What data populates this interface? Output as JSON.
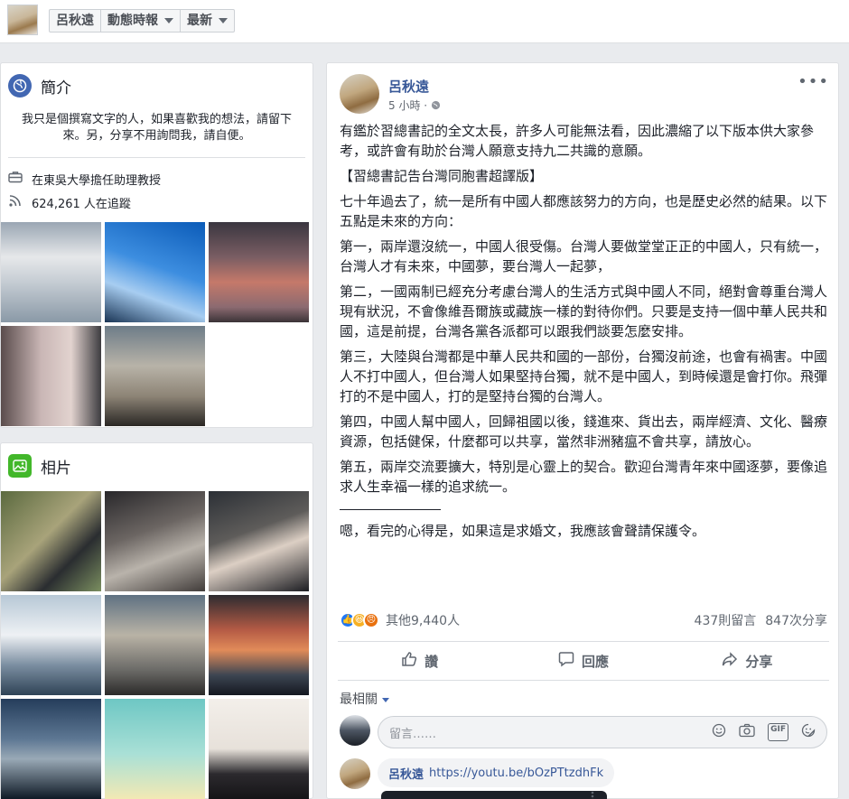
{
  "topbar": {
    "name": "呂秋遠",
    "feed_label": "動態時報",
    "sort_label": "最新"
  },
  "intro": {
    "title": "簡介",
    "bio": "我只是個撰寫文字的人，如果喜歡我的想法，請留下來。另，分享不用詢問我，請自便。",
    "job": "在東吳大學擔任助理教授",
    "followers": "624,261 人在追蹤"
  },
  "photos": {
    "title": "相片"
  },
  "post": {
    "author": "呂秋遠",
    "time": "5 小時 · ",
    "more": "•••",
    "paragraphs": [
      "有鑑於習總書記的全文太長，許多人可能無法看，因此濃縮了以下版本供大家參考，或許會有助於台灣人願意支持九二共識的意願。",
      "【習總書記告台灣同胞書超譯版】",
      "七十年過去了，統一是所有中國人都應該努力的方向，也是歷史必然的結果。以下五點是未來的方向：",
      "第一，兩岸還沒統一，中國人很受傷。台灣人要做堂堂正正的中國人，只有統一，台灣人才有未來，中國夢，要台灣人一起夢，",
      "第二，一國兩制已經充分考慮台灣人的生活方式與中國人不同，絕對會尊重台灣人現有狀況，不會像維吾爾族或藏族一樣的對待你們。只要是支持一個中華人民共和國，這是前提，台灣各黨各派都可以跟我們談要怎麼安排。",
      "第三，大陸與台灣都是中華人民共和國的一部份，台獨沒前途，也會有禍害。中國人不打中國人，但台灣人如果堅持台獨，就不是中國人，到時候還是會打你。飛彈打的不是中國人，打的是堅持台獨的台灣人。",
      "第四，中國人幫中國人，回歸祖國以後，錢進來、貨出去，兩岸經濟、文化、醫療資源，包括健保，什麼都可以共享，當然非洲豬瘟不會共享，請放心。",
      "第五，兩岸交流要擴大，特別是心靈上的契合。歡迎台灣青年來中國逐夢，要像追求人生幸福一樣的追求統一。"
    ],
    "closing": "嗯，看完的心得是，如果這是求婚文，我應該會聲請保護令。",
    "reactions_count": "其他9,440人",
    "comments_count": "437則留言",
    "shares_count": "847次分享",
    "like_label": "讚",
    "comment_label": "回應",
    "share_label": "分享",
    "sort_label": "最相關",
    "comment_placeholder": "留言……",
    "reply_author": "呂秋遠",
    "reply_link": "https://youtu.be/bOzPTtzdhFk"
  }
}
